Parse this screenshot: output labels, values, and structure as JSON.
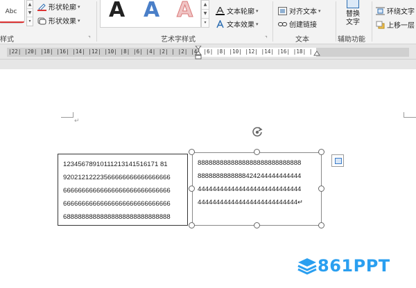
{
  "ribbon": {
    "shape_styles": {
      "preview_label": "Abc",
      "shape_outline": "形状轮廓",
      "shape_effects": "形状效果",
      "group_label": "样式"
    },
    "wordart_styles": {
      "letters": [
        "A",
        "A",
        "A"
      ],
      "letter_colors": [
        "#111111",
        "#4a7fc8",
        "#e8a3a3"
      ],
      "text_outline": "文本轮廓",
      "text_effects": "文本效果",
      "group_label": "艺术字样式"
    },
    "text_group": {
      "align_text": "对齐文本",
      "create_link": "创建链接",
      "group_label": "文本"
    },
    "accessibility_group": {
      "alt_text_line1": "替换",
      "alt_text_line2": "文字",
      "group_label": "辅助功能"
    },
    "arrange_group": {
      "wrap_text": "环绕文字",
      "bring_forward": "上移一层"
    }
  },
  "ruler": {
    "text": "|22|  |20|  |18|  |16|  |14|  |12|  |10|  |8|  |6|  |4|  |2|  |    |2|  |4|  |6|  |8|  |10|  |12|  |14|  |16|  |18|  |"
  },
  "document": {
    "paragraph_mark": "↵",
    "textbox1_lines": [
      "12345678910111213141516171 81",
      "92021212223566666666666666666",
      "66666666666666666666666666666",
      "66666666666666666666666666666",
      "68888888888888888888888888888"
    ],
    "textbox2_lines": [
      "8888888888888888888888888888",
      "8888888888888424244444444444",
      "4444444444444444444444444444",
      "444444444444444444444444444↵"
    ]
  },
  "watermark": {
    "text": "861PPT",
    "color": "#2a9ff0"
  }
}
